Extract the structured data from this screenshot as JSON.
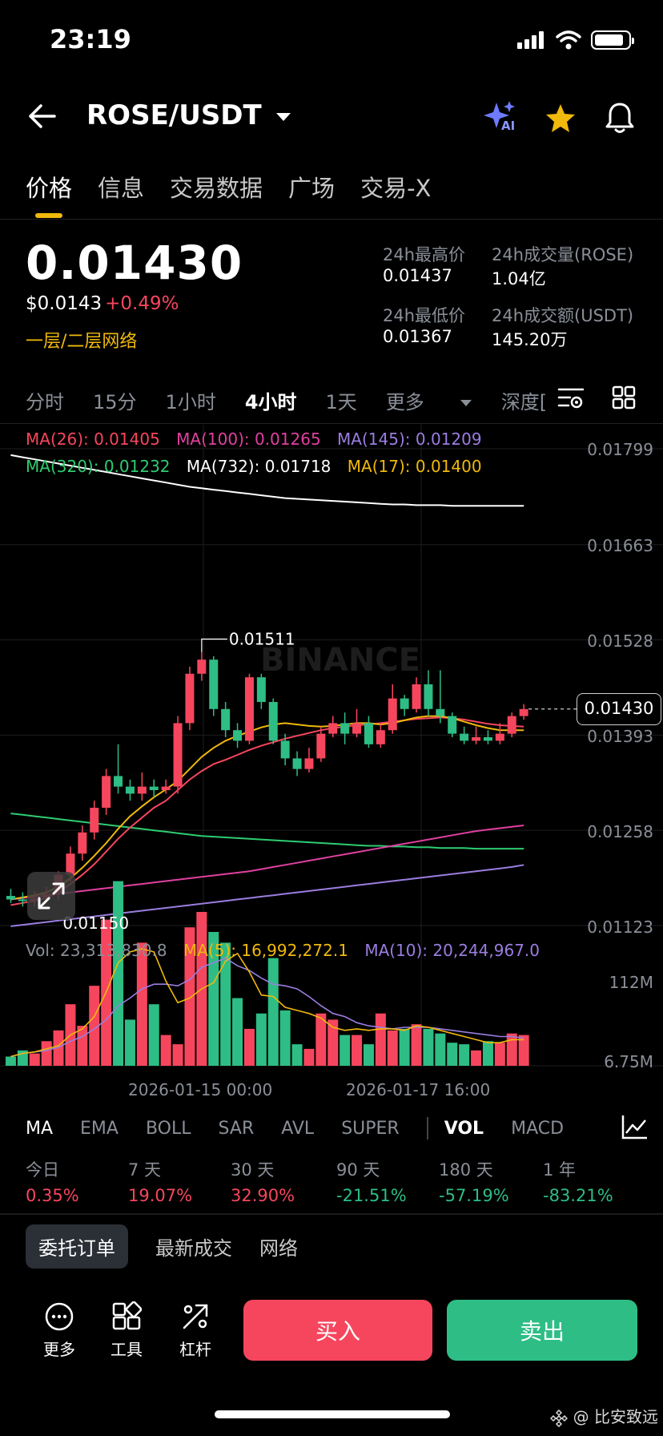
{
  "status_bar": {
    "time": "23:19"
  },
  "header": {
    "pair": "ROSE/USDT",
    "ai_badge": "AI"
  },
  "tabs": [
    "价格",
    "信息",
    "交易数据",
    "广场",
    "交易-X"
  ],
  "ticker": {
    "last_price": "0.01430",
    "usd_price": "$0.0143",
    "change": "+0.49%",
    "network": "一层/二层网络",
    "high_label": "24h最高价",
    "high": "0.01437",
    "vol_base_label": "24h成交量(ROSE)",
    "vol_base": "1.04亿",
    "low_label": "24h最低价",
    "low": "0.01367",
    "vol_quote_label": "24h成交额(USDT)",
    "vol_quote": "145.20万"
  },
  "intervals": [
    "分时",
    "15分",
    "1小时",
    "4小时",
    "1天",
    "更多",
    "深度["
  ],
  "ma_legend": {
    "ma26": "MA(26): 0.01405",
    "ma100": "MA(100): 0.01265",
    "ma145": "MA(145): 0.01209",
    "ma320": "MA(320): 0.01232",
    "ma732": "MA(732): 0.01718",
    "ma17": "MA(17): 0.01400"
  },
  "price_axis": [
    "0.01799",
    "0.01663",
    "0.01528",
    "0.01393",
    "0.01258",
    "0.01123"
  ],
  "watermark": "BINANCE",
  "current_price_tag": "0.01430",
  "high_annotation": "0.01511",
  "low_annotation": "0.01150",
  "volume_legend": {
    "vol": "Vol: 23,313,830.8",
    "ma5": "MA(5): 16,992,272.1",
    "ma10": "MA(10): 20,244,967.0"
  },
  "volume_axis": [
    "112M",
    "6.75M"
  ],
  "time_axis": [
    "2026-01-15 00:00",
    "2026-01-17 16:00"
  ],
  "indicators": [
    "MA",
    "EMA",
    "BOLL",
    "SAR",
    "AVL",
    "SUPER",
    "VOL",
    "MACD"
  ],
  "performance": [
    {
      "label": "今日",
      "value": "0.35%"
    },
    {
      "label": "7 天",
      "value": "19.07%"
    },
    {
      "label": "30 天",
      "value": "32.90%"
    },
    {
      "label": "90 天",
      "value": "-21.51%"
    },
    {
      "label": "180 天",
      "value": "-57.19%"
    },
    {
      "label": "1 年",
      "value": "-83.21%"
    }
  ],
  "order_tabs": [
    "委托订单",
    "最新成交",
    "网络"
  ],
  "bottom_bar": {
    "more": "更多",
    "tools": "工具",
    "leverage": "杠杆",
    "buy": "买入",
    "sell": "卖出"
  },
  "footer_watermark": "@ 比安致远",
  "colors": {
    "up": "#f6465d",
    "down": "#2ebd85",
    "accent": "#f0b90b",
    "ma26": "#f6465d",
    "ma100": "#e040a0",
    "ma145": "#9b7de0",
    "ma320": "#2ecc71",
    "ma732": "#ffffff",
    "ma17": "#f0b90b"
  },
  "chart_data": {
    "type": "candlestick",
    "price_axis_ticks": [
      0.01799,
      0.01663,
      0.01528,
      0.01393,
      0.01258,
      0.01123
    ],
    "candles": [
      [
        0.01165,
        0.0116,
        0.01175,
        0.01155
      ],
      [
        0.0116,
        0.01158,
        0.0117,
        0.0115
      ],
      [
        0.01158,
        0.01162,
        0.01172,
        0.0115
      ],
      [
        0.01162,
        0.01168,
        0.01178,
        0.01155
      ],
      [
        0.01168,
        0.01195,
        0.012,
        0.0116
      ],
      [
        0.01195,
        0.01225,
        0.01235,
        0.01185
      ],
      [
        0.01225,
        0.01255,
        0.01265,
        0.01215
      ],
      [
        0.01255,
        0.0129,
        0.013,
        0.01245
      ],
      [
        0.0129,
        0.01335,
        0.01345,
        0.0128
      ],
      [
        0.01335,
        0.0132,
        0.0138,
        0.0131
      ],
      [
        0.0132,
        0.0131,
        0.0133,
        0.013
      ],
      [
        0.0131,
        0.0132,
        0.0134,
        0.013
      ],
      [
        0.0132,
        0.01315,
        0.0133,
        0.01305
      ],
      [
        0.01315,
        0.0132,
        0.0133,
        0.0131
      ],
      [
        0.0132,
        0.0141,
        0.0142,
        0.0131
      ],
      [
        0.0141,
        0.0148,
        0.0149,
        0.014
      ],
      [
        0.0148,
        0.015,
        0.01511,
        0.0147
      ],
      [
        0.015,
        0.0143,
        0.01505,
        0.0142
      ],
      [
        0.0143,
        0.014,
        0.0144,
        0.0139
      ],
      [
        0.014,
        0.01385,
        0.0141,
        0.01375
      ],
      [
        0.01385,
        0.01475,
        0.0148,
        0.0138
      ],
      [
        0.01475,
        0.0144,
        0.0148,
        0.0143
      ],
      [
        0.0144,
        0.01385,
        0.01445,
        0.0138
      ],
      [
        0.01385,
        0.0136,
        0.01395,
        0.0135
      ],
      [
        0.0136,
        0.01345,
        0.0137,
        0.01335
      ],
      [
        0.01345,
        0.0136,
        0.01375,
        0.0134
      ],
      [
        0.0136,
        0.01395,
        0.01405,
        0.01355
      ],
      [
        0.01395,
        0.0141,
        0.0142,
        0.0139
      ],
      [
        0.0141,
        0.01395,
        0.01425,
        0.0138
      ],
      [
        0.01395,
        0.0141,
        0.0143,
        0.0139
      ],
      [
        0.0141,
        0.0138,
        0.0142,
        0.01375
      ],
      [
        0.0138,
        0.014,
        0.0141,
        0.01375
      ],
      [
        0.014,
        0.01445,
        0.01465,
        0.01395
      ],
      [
        0.01445,
        0.0143,
        0.0145,
        0.0142
      ],
      [
        0.0143,
        0.01465,
        0.01475,
        0.01425
      ],
      [
        0.01465,
        0.0143,
        0.01485,
        0.0142
      ],
      [
        0.0143,
        0.0142,
        0.01485,
        0.0141
      ],
      [
        0.0142,
        0.01395,
        0.01425,
        0.0139
      ],
      [
        0.01395,
        0.01385,
        0.01405,
        0.0138
      ],
      [
        0.01385,
        0.0139,
        0.01405,
        0.0138
      ],
      [
        0.0139,
        0.01385,
        0.014,
        0.0138
      ],
      [
        0.01385,
        0.01395,
        0.0141,
        0.0138
      ],
      [
        0.01395,
        0.0142,
        0.01425,
        0.0139
      ],
      [
        0.0142,
        0.0143,
        0.01437,
        0.01415
      ]
    ],
    "volume": [
      0.6,
      1.0,
      0.8,
      1.6,
      2.3,
      4.0,
      2.6,
      5.2,
      9.5,
      12.0,
      3.0,
      8.0,
      4.0,
      2.0,
      1.4,
      9.0,
      10.0,
      8.7,
      8.0,
      4.4,
      2.4,
      3.4,
      7.0,
      3.6,
      1.4,
      1.1,
      3.4,
      3.0,
      2.0,
      2.0,
      1.4,
      3.4,
      2.3,
      2.4,
      2.7,
      2.4,
      2.1,
      1.5,
      1.4,
      1.0,
      1.6,
      1.5,
      2.1,
      2.0
    ],
    "ma26": [
      0.01152,
      0.01155,
      0.01158,
      0.01162,
      0.0117,
      0.01182,
      0.01195,
      0.0121,
      0.01228,
      0.01246,
      0.01262,
      0.01276,
      0.0129,
      0.013,
      0.01315,
      0.0133,
      0.01342,
      0.01352,
      0.01358,
      0.01365,
      0.01372,
      0.01378,
      0.01383,
      0.01388,
      0.01392,
      0.01396,
      0.014,
      0.01403,
      0.01405,
      0.01407,
      0.01408,
      0.0141,
      0.01412,
      0.01414,
      0.01416,
      0.01417,
      0.01418,
      0.01417,
      0.01415,
      0.01412,
      0.01409,
      0.01407,
      0.01406,
      0.01405
    ],
    "ma17": [
      0.0116,
      0.01163,
      0.01166,
      0.0117,
      0.01178,
      0.0119,
      0.01205,
      0.01222,
      0.0124,
      0.0126,
      0.01278,
      0.01292,
      0.01305,
      0.01316,
      0.01328,
      0.01345,
      0.01362,
      0.01375,
      0.01385,
      0.01392,
      0.01398,
      0.01404,
      0.01408,
      0.0141,
      0.01408,
      0.01406,
      0.01405,
      0.01406,
      0.01408,
      0.0141,
      0.0141,
      0.01408,
      0.0141,
      0.01414,
      0.01418,
      0.0142,
      0.0142,
      0.01417,
      0.01412,
      0.01407,
      0.01403,
      0.014,
      0.014,
      0.014
    ],
    "ma100": [
      0.0116,
      0.01162,
      0.01164,
      0.01166,
      0.01168,
      0.0117,
      0.01172,
      0.01174,
      0.01176,
      0.01178,
      0.0118,
      0.01182,
      0.01184,
      0.01186,
      0.01188,
      0.0119,
      0.01192,
      0.01194,
      0.01196,
      0.01198,
      0.012,
      0.01203,
      0.01206,
      0.01209,
      0.01212,
      0.01215,
      0.01218,
      0.01221,
      0.01224,
      0.01227,
      0.0123,
      0.01233,
      0.01236,
      0.01239,
      0.01242,
      0.01245,
      0.01248,
      0.01251,
      0.01254,
      0.01257,
      0.01259,
      0.01261,
      0.01263,
      0.01265
    ],
    "ma145": [
      0.01122,
      0.01124,
      0.01126,
      0.01128,
      0.0113,
      0.01132,
      0.01134,
      0.01136,
      0.01138,
      0.0114,
      0.01142,
      0.01144,
      0.01146,
      0.01148,
      0.0115,
      0.01152,
      0.01154,
      0.01156,
      0.01158,
      0.0116,
      0.01162,
      0.01164,
      0.01166,
      0.01168,
      0.0117,
      0.01172,
      0.01174,
      0.01176,
      0.01178,
      0.0118,
      0.01182,
      0.01184,
      0.01186,
      0.01188,
      0.0119,
      0.01192,
      0.01194,
      0.01196,
      0.01198,
      0.012,
      0.01202,
      0.01204,
      0.01206,
      0.01209
    ],
    "ma320": [
      0.01282,
      0.0128,
      0.01278,
      0.01276,
      0.01274,
      0.01272,
      0.0127,
      0.01268,
      0.01266,
      0.01264,
      0.01262,
      0.0126,
      0.01258,
      0.01256,
      0.01254,
      0.01252,
      0.0125,
      0.01249,
      0.01248,
      0.01247,
      0.01246,
      0.01245,
      0.01244,
      0.01243,
      0.01242,
      0.01241,
      0.0124,
      0.01239,
      0.01238,
      0.01237,
      0.01236,
      0.01236,
      0.01235,
      0.01235,
      0.01234,
      0.01234,
      0.01233,
      0.01233,
      0.01233,
      0.01232,
      0.01232,
      0.01232,
      0.01232,
      0.01232
    ],
    "ma732": [
      0.0179,
      0.01787,
      0.01784,
      0.01781,
      0.01778,
      0.01775,
      0.01772,
      0.01769,
      0.01766,
      0.01763,
      0.0176,
      0.01757,
      0.01754,
      0.01751,
      0.01748,
      0.01745,
      0.01743,
      0.01741,
      0.01739,
      0.01737,
      0.01735,
      0.01733,
      0.01731,
      0.01729,
      0.01728,
      0.01727,
      0.01726,
      0.01725,
      0.01724,
      0.01723,
      0.01722,
      0.01721,
      0.0172,
      0.0172,
      0.01719,
      0.01719,
      0.01719,
      0.01718,
      0.01718,
      0.01718,
      0.01718,
      0.01718,
      0.01718,
      0.01718
    ],
    "vol_ma5": [
      0.6,
      0.8,
      0.9,
      1.1,
      1.3,
      2.0,
      2.4,
      3.2,
      4.8,
      6.7,
      7.4,
      7.6,
      7.4,
      5.5,
      4.1,
      4.4,
      5.0,
      5.4,
      6.8,
      7.3,
      6.1,
      4.6,
      4.5,
      3.8,
      3.6,
      3.4,
      3.1,
      2.5,
      2.3,
      2.4,
      2.3,
      2.4,
      2.4,
      2.3,
      2.6,
      2.5,
      2.3,
      2.1,
      1.9,
      1.7,
      1.5,
      1.5,
      1.7,
      1.7
    ],
    "vol_ma10": [
      0.6,
      0.8,
      0.9,
      1.0,
      1.2,
      1.6,
      1.9,
      2.4,
      3.0,
      3.9,
      4.4,
      5.0,
      5.3,
      5.3,
      5.2,
      5.6,
      6.4,
      6.7,
      7.0,
      6.5,
      6.2,
      5.7,
      5.3,
      5.2,
      5.0,
      4.5,
      3.9,
      3.4,
      3.2,
      2.8,
      2.6,
      2.5,
      2.4,
      2.5,
      2.5,
      2.5,
      2.4,
      2.3,
      2.2,
      2.1,
      2.0,
      1.9,
      1.9,
      1.8
    ],
    "volume_axis_ticks_M": [
      112,
      6.75
    ]
  }
}
